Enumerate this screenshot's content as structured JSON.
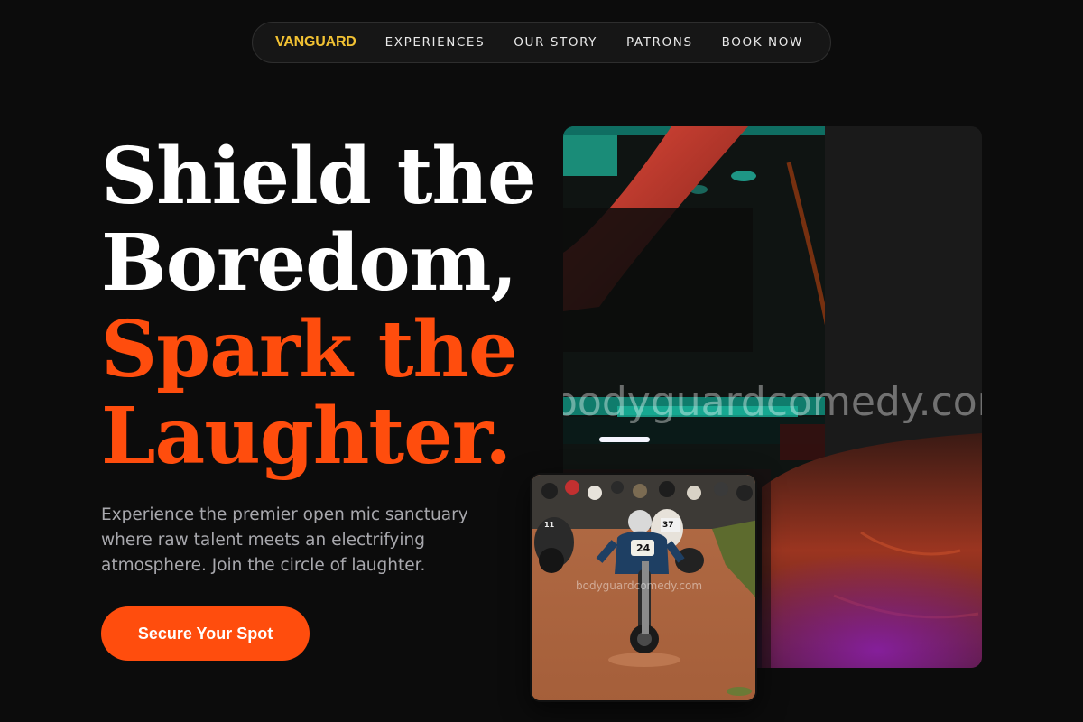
{
  "nav": {
    "brand": "VANGUARD",
    "links": [
      "EXPERIENCES",
      "OUR STORY",
      "PATRONS",
      "BOOK NOW"
    ]
  },
  "hero": {
    "line1": "Shield the",
    "line2": "Boredom,",
    "line3": "Spark the",
    "line4": "Laughter.",
    "subtext": "Experience the premier open mic sanctuary where raw talent meets an electrifying atmosphere. Join the circle of laughter.",
    "cta_label": "Secure Your Spot"
  },
  "images": {
    "main_watermark": "bodyguardcomedy.com",
    "card_watermark": "bodyguardcomedy.com",
    "card_bib_left": "24",
    "card_bib_back": "37",
    "card_bib_side": "11"
  },
  "colors": {
    "background": "#0c0c0c",
    "brand": "#f2c233",
    "accent": "#ff4d0d",
    "subtext": "#a8a8ad"
  }
}
